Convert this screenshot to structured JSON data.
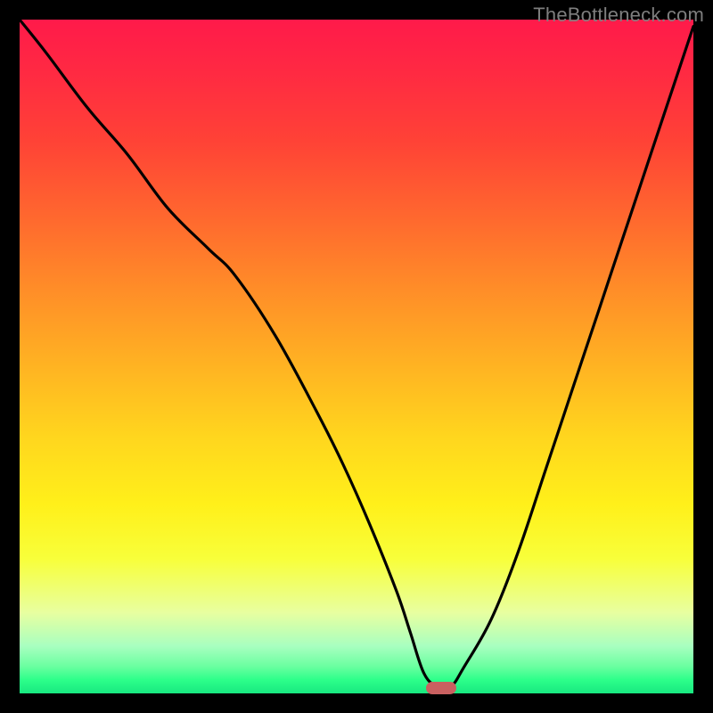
{
  "watermark": "TheBottleneck.com",
  "marker": {
    "x_frac": 0.625,
    "y_frac": 0.992
  },
  "chart_data": {
    "type": "line",
    "title": "",
    "xlabel": "",
    "ylabel": "",
    "xlim": [
      0,
      100
    ],
    "ylim": [
      0,
      100
    ],
    "grid": false,
    "legend": false,
    "annotations": [
      {
        "text": "TheBottleneck.com",
        "position": "top-right"
      }
    ],
    "series": [
      {
        "name": "bottleneck-curve",
        "x": [
          0,
          4,
          10,
          16,
          22,
          28,
          32,
          38,
          44,
          48,
          52,
          56,
          58,
          60,
          62,
          64,
          66,
          70,
          74,
          78,
          82,
          86,
          90,
          94,
          98,
          100
        ],
        "values": [
          100,
          95,
          87,
          80,
          72,
          66,
          62,
          53,
          42,
          34,
          25,
          15,
          9,
          3,
          1,
          1,
          4,
          11,
          21,
          33,
          45,
          57,
          69,
          81,
          93,
          99
        ]
      }
    ],
    "background_gradient": {
      "type": "vertical",
      "stops": [
        {
          "pos": 0.0,
          "color": "#ff1a4a"
        },
        {
          "pos": 0.3,
          "color": "#ff6a2e"
        },
        {
          "pos": 0.62,
          "color": "#ffd61e"
        },
        {
          "pos": 0.88,
          "color": "#e8ffa0"
        },
        {
          "pos": 1.0,
          "color": "#18e880"
        }
      ]
    },
    "marker": {
      "x": 62.5,
      "color": "#c96060",
      "shape": "rounded-bar"
    }
  }
}
